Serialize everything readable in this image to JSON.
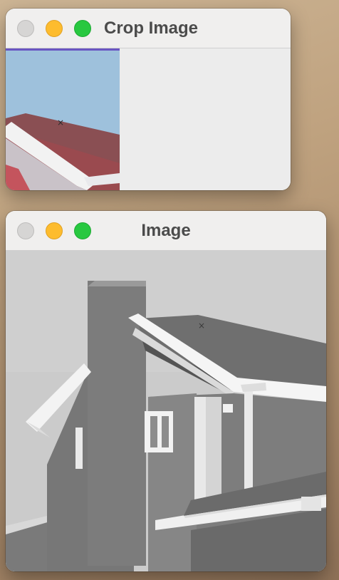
{
  "windows": {
    "crop": {
      "title": "Crop Image",
      "image": "color-crop-of-house-roof"
    },
    "image": {
      "title": "Image",
      "image": "grayscale-house-photo"
    }
  },
  "colors": {
    "close": "#d6d5d4",
    "minimize": "#fdbc2e",
    "maximize": "#28c840",
    "crop_accent": "#6a55c2"
  }
}
